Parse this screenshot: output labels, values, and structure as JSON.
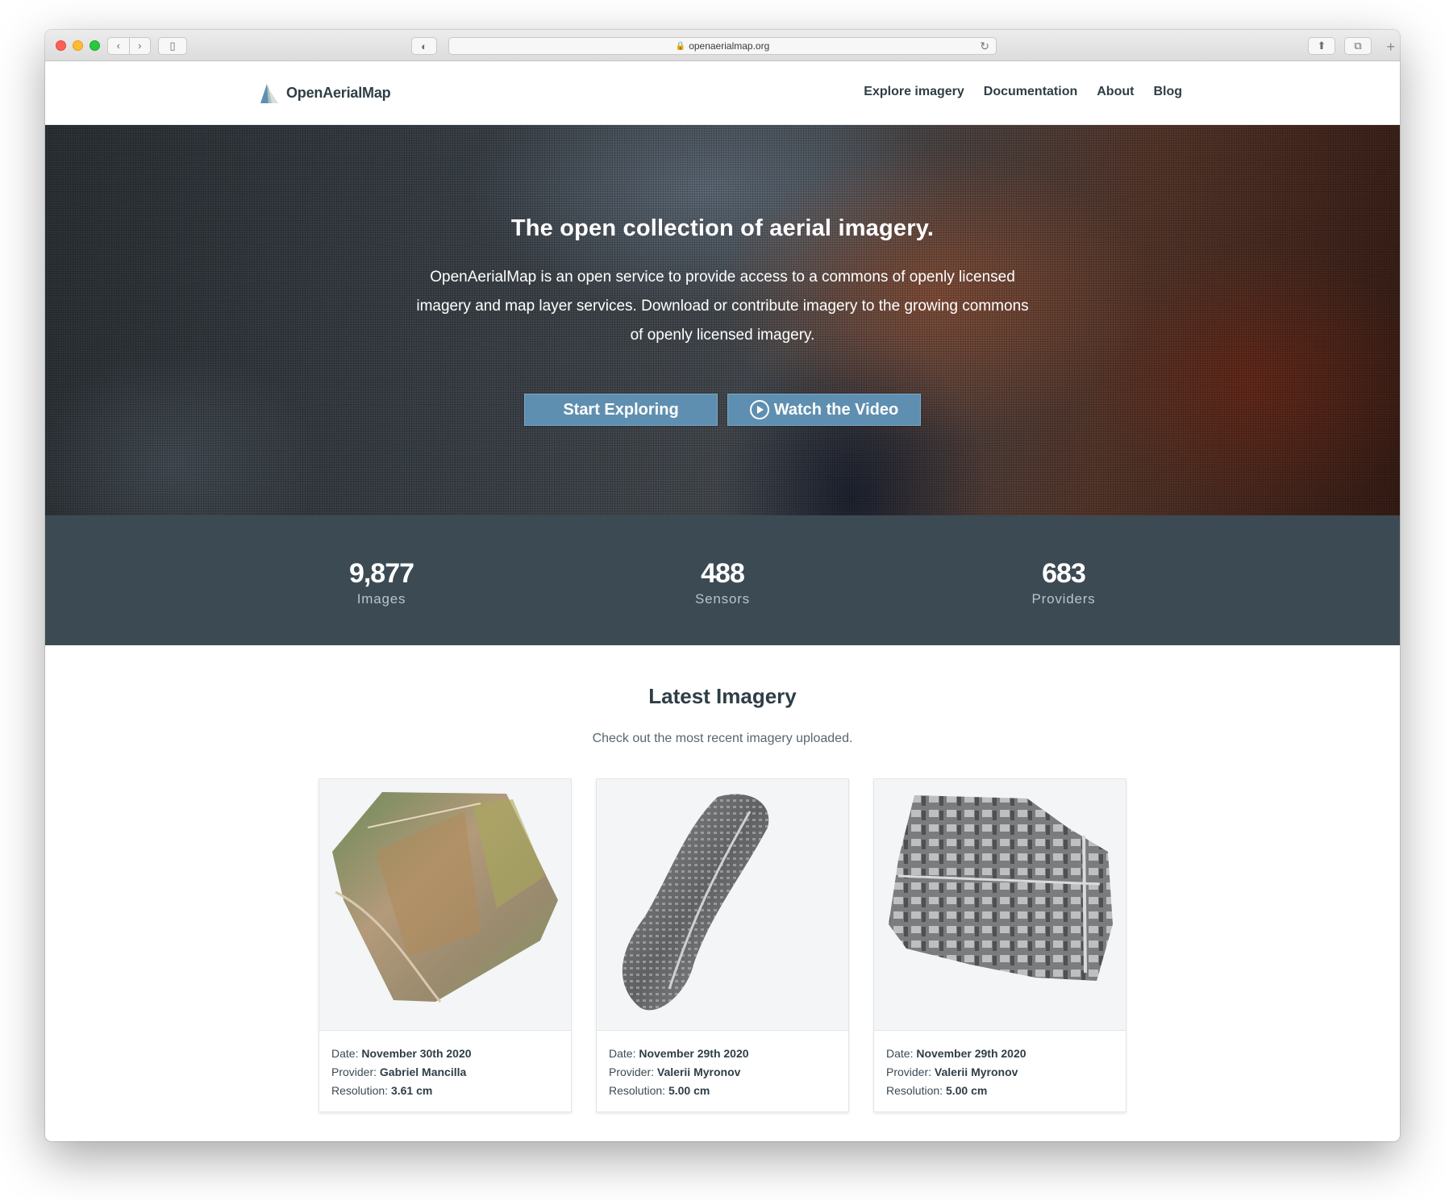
{
  "browser": {
    "url": "openaerialmap.org"
  },
  "header": {
    "logo_text": "OpenAerialMap",
    "nav": [
      "Explore imagery",
      "Documentation",
      "About",
      "Blog"
    ]
  },
  "hero": {
    "title": "The open collection of aerial imagery.",
    "lead": "OpenAerialMap is an open service to provide access to a commons of openly licensed imagery and map layer services. Download or contribute imagery to the growing commons of openly licensed imagery.",
    "start_label": "Start Exploring",
    "video_label": "Watch the Video"
  },
  "stats": [
    {
      "value": "9,877",
      "label": "Images"
    },
    {
      "value": "488",
      "label": "Sensors"
    },
    {
      "value": "683",
      "label": "Providers"
    }
  ],
  "latest": {
    "title": "Latest Imagery",
    "subtitle": "Check out the most recent imagery uploaded.",
    "field_labels": {
      "date": "Date:",
      "provider": "Provider:",
      "resolution": "Resolution:"
    },
    "cards": [
      {
        "date": "November 30th 2020",
        "provider": "Gabriel Mancilla",
        "resolution": "3.61 cm"
      },
      {
        "date": "November 29th 2020",
        "provider": "Valerii Myronov",
        "resolution": "5.00 cm"
      },
      {
        "date": "November 29th 2020",
        "provider": "Valerii Myronov",
        "resolution": "5.00 cm"
      }
    ]
  },
  "colors": {
    "brand_dark": "#2f3e46",
    "button_blue": "#5f8fb0",
    "stats_bg": "#3c4a53"
  }
}
